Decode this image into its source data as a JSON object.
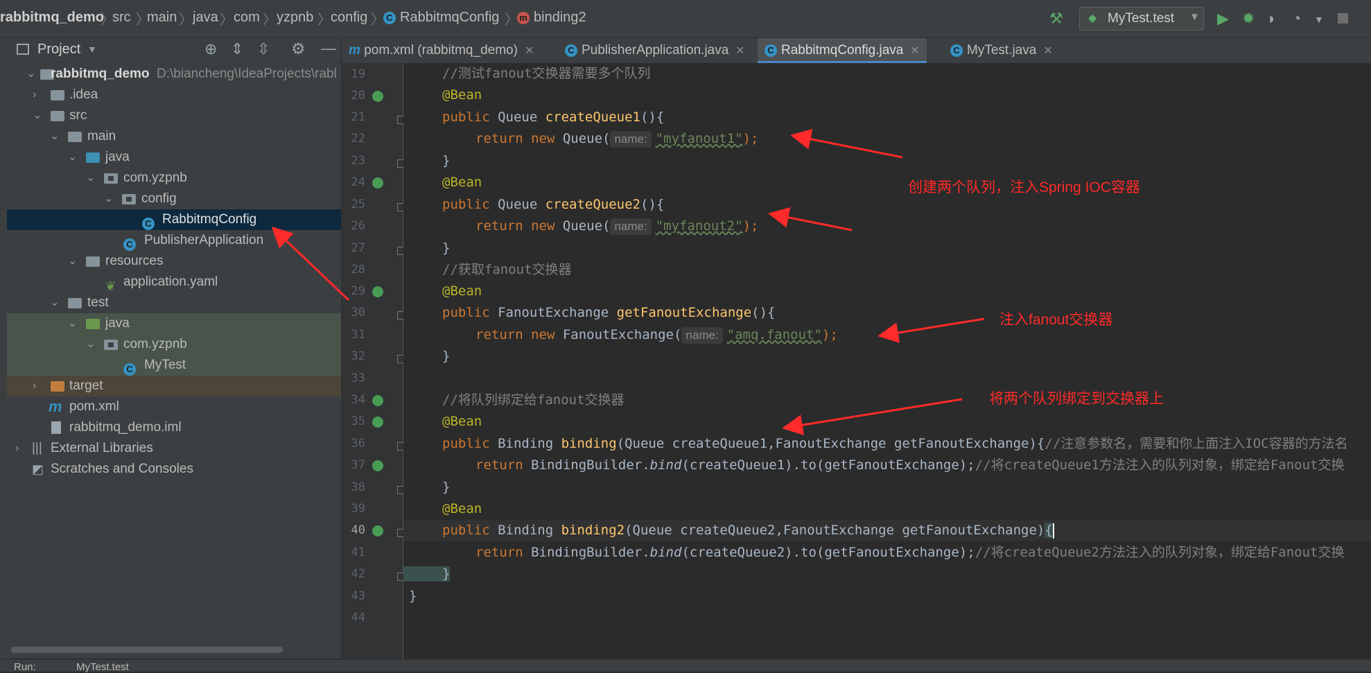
{
  "breadcrumb": [
    "rabbitmq_demo",
    "src",
    "main",
    "java",
    "com",
    "yzpnb",
    "config",
    "RabbitmqConfig",
    "binding2"
  ],
  "run_config": "MyTest.test",
  "project_panel": {
    "title": "Project",
    "tree": [
      {
        "label": "rabbitmq_demo",
        "hint": "D:\\biancheng\\IdeaProjects\\rabl"
      },
      {
        "label": ".idea"
      },
      {
        "label": "src"
      },
      {
        "label": "main"
      },
      {
        "label": "java"
      },
      {
        "label": "com.yzpnb"
      },
      {
        "label": "config"
      },
      {
        "label": "RabbitmqConfig"
      },
      {
        "label": "PublisherApplication"
      },
      {
        "label": "resources"
      },
      {
        "label": "application.yaml"
      },
      {
        "label": "test"
      },
      {
        "label": "java"
      },
      {
        "label": "com.yzpnb"
      },
      {
        "label": "MyTest"
      },
      {
        "label": "target"
      },
      {
        "label": "pom.xml"
      },
      {
        "label": "rabbitmq_demo.iml"
      },
      {
        "label": "External Libraries"
      },
      {
        "label": "Scratches and Consoles"
      }
    ]
  },
  "tabs": [
    {
      "label": "pom.xml (rabbitmq_demo)"
    },
    {
      "label": "PublisherApplication.java"
    },
    {
      "label": "RabbitmqConfig.java"
    },
    {
      "label": "MyTest.java"
    }
  ],
  "line_numbers": [
    "19",
    "20",
    "21",
    "22",
    "23",
    "24",
    "25",
    "26",
    "27",
    "28",
    "29",
    "30",
    "31",
    "32",
    "33",
    "34",
    "35",
    "36",
    "37",
    "38",
    "39",
    "40",
    "41",
    "42",
    "43",
    "44"
  ],
  "code": {
    "l19": "//测试fanout交换器需要多个队列",
    "l20": "@Bean",
    "l21_kw": "public",
    "l21_type": " Queue ",
    "l21_fn": "createQueue1",
    "l21_rest": "(){",
    "l22_kw": "return new",
    "l22_a": " Queue(",
    "l22_hint": "name:",
    "l22_str": "\"myfanout1\"",
    "l22_end": ");",
    "l23": "}",
    "l24": "@Bean",
    "l25_kw": "public",
    "l25_type": " Queue ",
    "l25_fn": "createQueue2",
    "l25_rest": "(){",
    "l26_kw": "return new",
    "l26_a": " Queue(",
    "l26_hint": "name:",
    "l26_str": "\"myfanout2\"",
    "l26_end": ");",
    "l27": "}",
    "l28": "//获取fanout交换器",
    "l29": "@Bean",
    "l30_kw": "public",
    "l30_type": " FanoutExchange ",
    "l30_fn": "getFanoutExchange",
    "l30_rest": "(){",
    "l31_kw": "return new",
    "l31_a": " FanoutExchange(",
    "l31_hint": "name:",
    "l31_str": "\"amq.fanout\"",
    "l31_end": ");",
    "l32": "}",
    "l34": "//将队列绑定给fanout交换器",
    "l35": "@Bean",
    "l36_kw": "public",
    "l36_type": " Binding ",
    "l36_fn": "binding",
    "l36_rest": "(Queue createQueue1,FanoutExchange getFanoutExchange){",
    "l36_cmt": "//注意参数名，需要和你上面注入IOC容器的方法名",
    "l37_kw": "return",
    "l37_a": " BindingBuilder.",
    "l37_it": "bind",
    "l37_b": "(createQueue1).to(getFanoutExchange);",
    "l37_cmt": "//将createQueue1方法注入的队列对象，绑定给Fanout交换",
    "l38": "}",
    "l39": "@Bean",
    "l40_kw": "public",
    "l40_type": " Binding ",
    "l40_fn": "binding2",
    "l40_rest": "(Queue createQueue2,FanoutExchange getFanoutExchange)",
    "l40_brace": "{",
    "l41_kw": "return",
    "l41_a": " BindingBuilder.",
    "l41_it": "bind",
    "l41_b": "(createQueue2).to(getFanoutExchange);",
    "l41_cmt": "//将createQueue2方法注入的队列对象，绑定给Fanout交换",
    "l42": "}",
    "l43": "}"
  },
  "annotations": {
    "queues": "创建两个队列，注入Spring IOC容器",
    "fanout": "注入fanout交换器",
    "bind": "将两个队列绑定到交换器上"
  },
  "bottom": {
    "run_label": "Run:",
    "run_tab": "MyTest.test"
  },
  "colors": {
    "arrow": "#ff2a2a",
    "selection": "#0d293e",
    "accent": "#4a88c7"
  }
}
